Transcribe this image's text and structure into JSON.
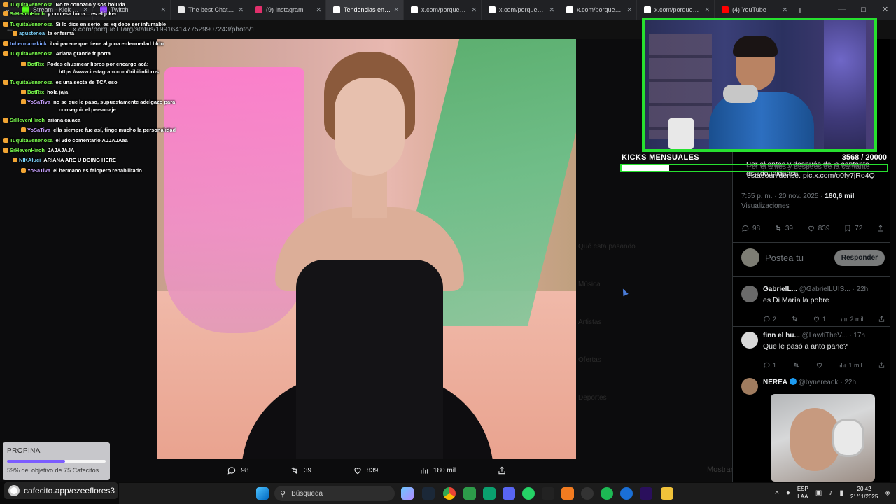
{
  "browser": {
    "tabs": [
      {
        "label": "Stream - Kick Dashboard",
        "color": "#53fc18",
        "active": false
      },
      {
        "label": "Twitch",
        "color": "#9146ff",
        "active": false
      },
      {
        "label": "The best ChatBot",
        "color": "#e8e8e8",
        "active": false
      },
      {
        "label": "(9) Instagram",
        "color": "#e1306c",
        "active": false
      },
      {
        "label": "Tendencias en Argentina",
        "color": "#ffffff",
        "active": true
      },
      {
        "label": "x.com/porqueTTarg",
        "color": "#ffffff",
        "active": false
      },
      {
        "label": "x.com/porqueTTarg",
        "color": "#ffffff",
        "active": false
      },
      {
        "label": "x.com/porqueTTarg",
        "color": "#ffffff",
        "active": false
      },
      {
        "label": "x.com/porqueTTarg",
        "color": "#ffffff",
        "active": false
      },
      {
        "label": "(4) YouTube",
        "color": "#ff0000",
        "active": false
      }
    ],
    "new_tab": "+",
    "url": "x.com/porqueTTarg/status/1991641477529907243/photo/1"
  },
  "photo_actions": [
    {
      "icon": "reply-icon",
      "value": "98"
    },
    {
      "icon": "retweet-icon",
      "value": "39"
    },
    {
      "icon": "like-icon",
      "value": "839"
    },
    {
      "icon": "views-icon",
      "value": "180 mil"
    },
    {
      "icon": "share-icon",
      "value": ""
    }
  ],
  "tweet": {
    "text": "Por el antes y después de la cantante estadounidense. pic.x.com/o0fy7jRo4Q",
    "time": "7:55 p. m. · 20 nov. 2025 · ",
    "views_count": "180,6 mil",
    "views_label": "Visualizaciones",
    "engagement": {
      "replies": "98",
      "retweets": "39",
      "likes": "839",
      "bookmarks": "72"
    },
    "reply_placeholder": "Postea tu",
    "reply_button": "Responder"
  },
  "replies": [
    {
      "name": "GabrielL...",
      "handle": "@GabrielLUIS... · 22h",
      "text": "es Di María la pobre",
      "replies": "2",
      "retweets": "",
      "likes": "1",
      "views": "2 mil",
      "avatar": "#6a6a6a"
    },
    {
      "name": "finn el hu...",
      "handle": "@LawtiTheV... · 17h",
      "text": "Que le pasó a anto pane?",
      "replies": "1",
      "retweets": "",
      "likes": "",
      "views": "1 mil",
      "avatar": "#d8d8d8"
    },
    {
      "name": "NEREA",
      "handle": "@bynereaok · 22h",
      "text": "",
      "avatar": "#a07c5f"
    }
  ],
  "chat": [
    {
      "user": "TuquitaVenenosa",
      "color": "#7cff4f",
      "text": "No te conozco y sos boluda"
    },
    {
      "user": "SrHevenHiroh",
      "color": "#7cff4f",
      "text": "y con esa boca... es el joker"
    },
    {
      "user": "TuquitaVenenosa",
      "color": "#7cff4f",
      "text": "Si lo dice en serio, es xq debe ser infumable"
    },
    {
      "user": "agustenea",
      "color": "#7fd6ff",
      "text": "ta enferma"
    },
    {
      "user": "tuhermanakick",
      "color": "#7fa9ff",
      "text": "ibai parece que tiene alguna enfermedad bldo"
    },
    {
      "user": "TuquitaVenenosa",
      "color": "#7cff4f",
      "text": "Ariana grande ft porta"
    },
    {
      "user": "BotRix",
      "color": "#7cff4f",
      "text": "Podes chusmear libros por encargo acá:"
    },
    {
      "user": "",
      "color": "#ffffff",
      "text": "https://www.instagram.com/tribilinlibros"
    },
    {
      "user": "TuquitaVenenosa",
      "color": "#7cff4f",
      "text": "es una secta de TCA eso"
    },
    {
      "user": "BotRix",
      "color": "#7cff4f",
      "text": "hola jaja"
    },
    {
      "user": "YoSaTiva",
      "color": "#c9a2ff",
      "text": "no se que le paso, supuestamente adelgazo para"
    },
    {
      "user": "",
      "color": "#ffffff",
      "text": "conseguir el personaje"
    },
    {
      "user": "SrHevenHiroh",
      "color": "#7cff4f",
      "text": "ariana calaca"
    },
    {
      "user": "YoSaTiva",
      "color": "#c9a2ff",
      "text": "ella siempre fue así, finge mucho la personalidad"
    },
    {
      "user": "TuquitaVenenosa",
      "color": "#7cff4f",
      "text": "el 2do comentario AJJAJAaa"
    },
    {
      "user": "SrHevenHiroh",
      "color": "#7cff4f",
      "text": "JAJAJAJA"
    },
    {
      "user": "NIKAluci",
      "color": "#7fd6ff",
      "text": "ARIANA  ARE U DOING HERE"
    },
    {
      "user": "YoSaTiva",
      "color": "#c9a2ff",
      "text": "el hermano es falopero rehabilitado"
    }
  ],
  "goal": {
    "label": "KICKS MENSUALES",
    "current": 3568,
    "target": 20000,
    "display": "3568  / 20000",
    "fill_fraction": 0.1784
  },
  "propina": {
    "title": "PROPINA",
    "progress_fraction": 0.59,
    "subtitle": "59% del objetivo de 75 Cafecitos"
  },
  "cafecito": "cafecito.app/ezeeflores3",
  "taskbar": {
    "search": "Búsqueda",
    "lang": "ESP",
    "lang_sub": "LAA",
    "time": "20:42",
    "date": "21/11/2025"
  },
  "ghost_menu": [
    "Qué está pasando",
    "Música",
    "Artistas",
    "Ofertas",
    "Deportes"
  ],
  "watermark": "Mostrar"
}
